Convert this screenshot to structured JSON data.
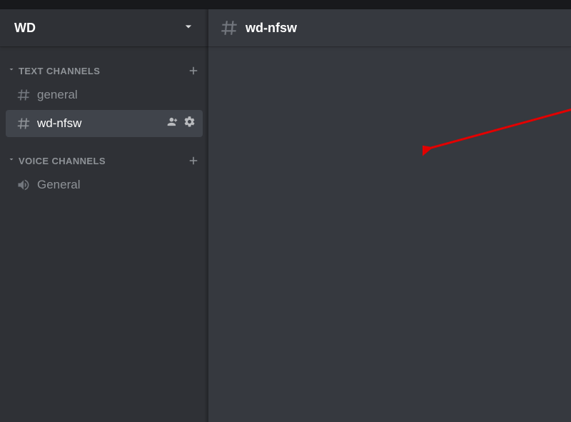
{
  "server": {
    "name": "WD"
  },
  "header": {
    "channel_name": "wd-nfsw"
  },
  "sidebar": {
    "categories": [
      {
        "label": "TEXT CHANNELS",
        "channels": [
          {
            "name": "general"
          },
          {
            "name": "wd-nfsw"
          }
        ]
      },
      {
        "label": "VOICE CHANNELS",
        "channels": [
          {
            "name": "General"
          }
        ]
      }
    ]
  }
}
